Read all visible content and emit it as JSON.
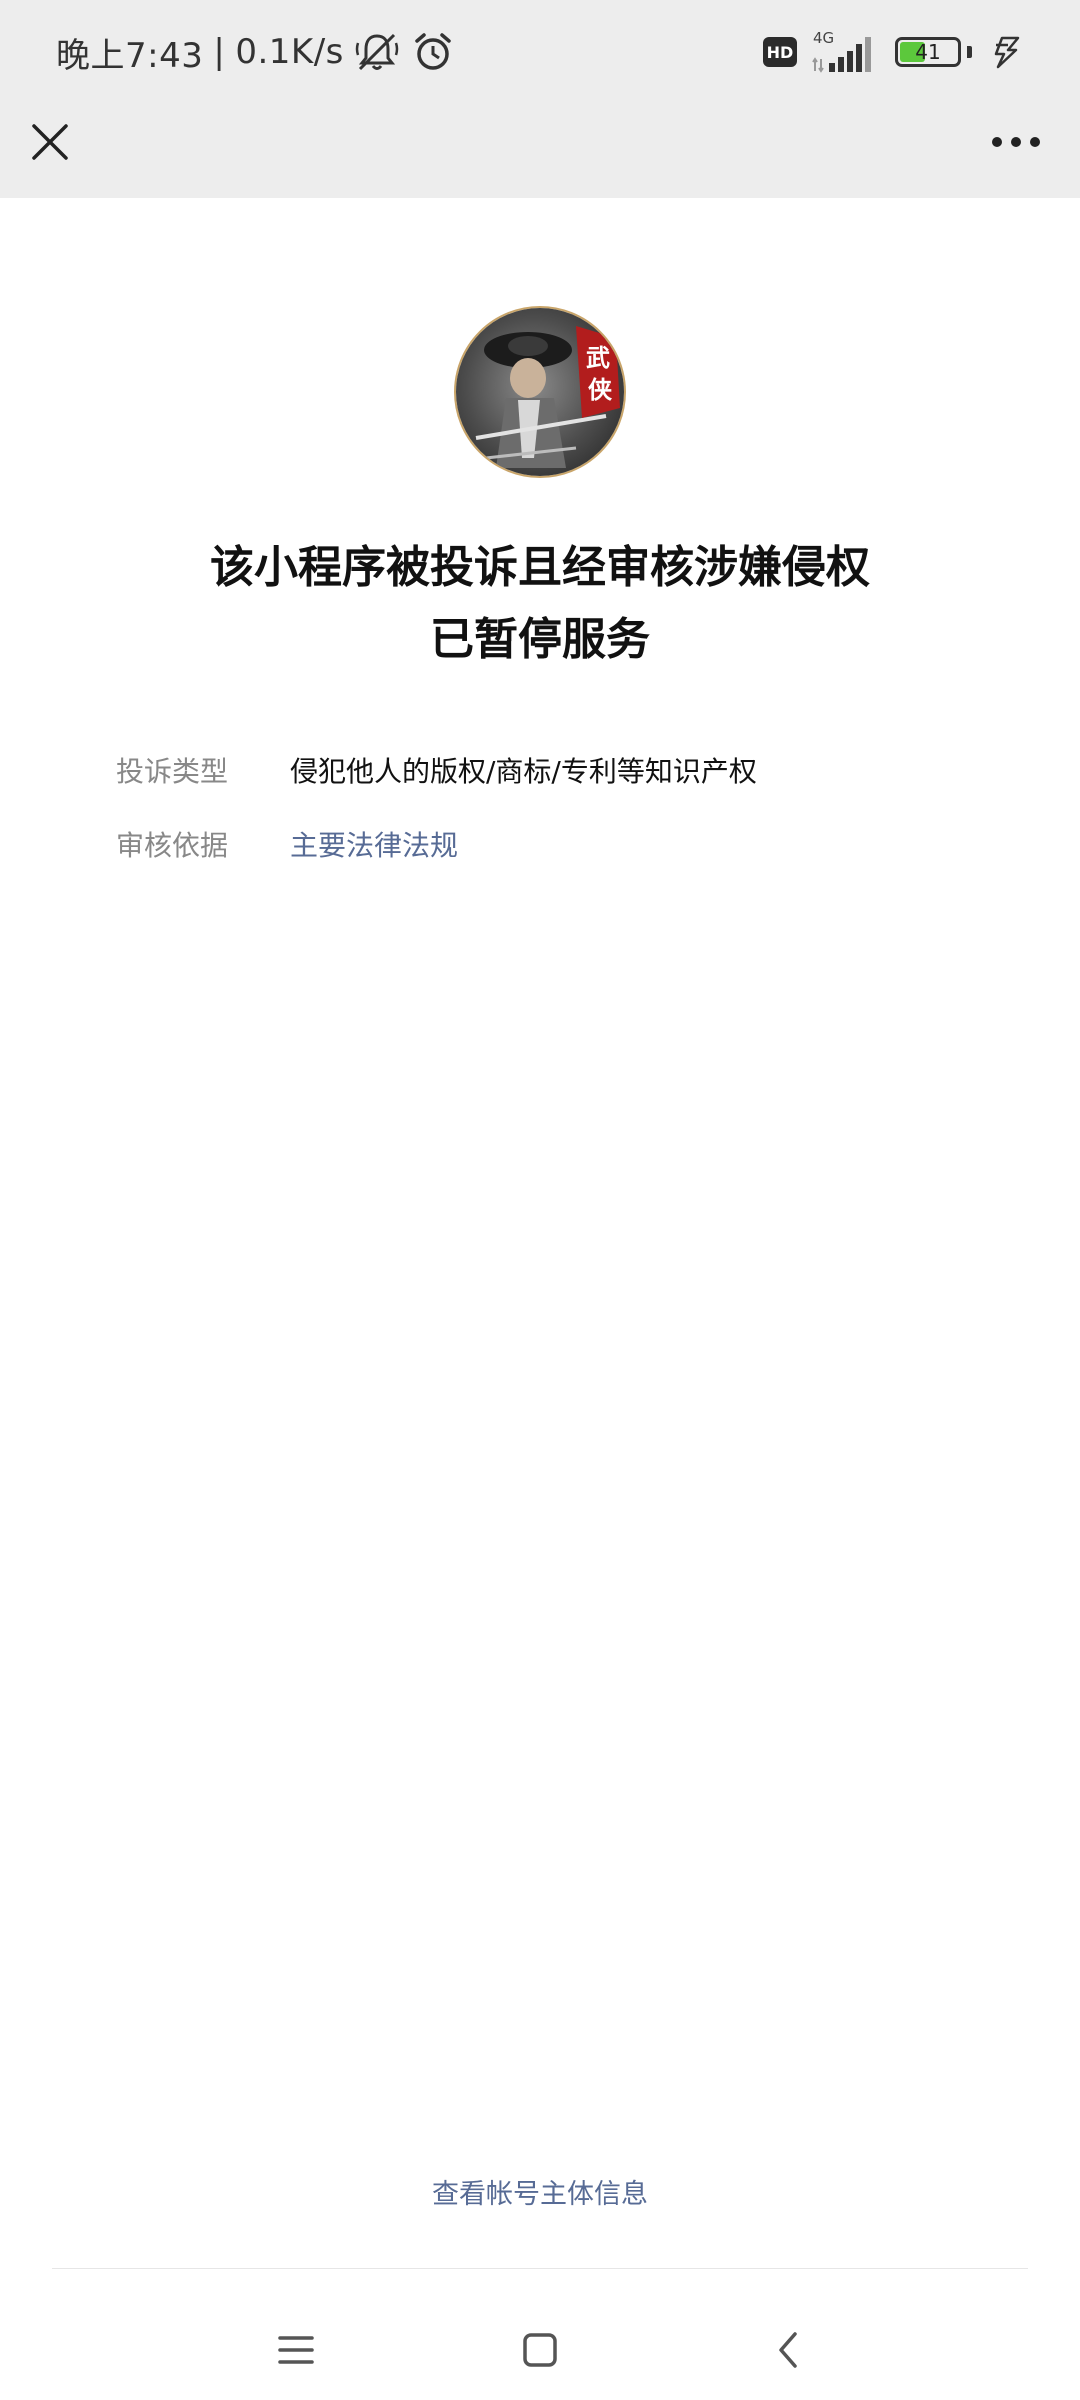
{
  "status_bar": {
    "time": "晚上7:43",
    "separator": "|",
    "net_speed": "0.1K/s",
    "hd_label": "HD",
    "network_type": "4G",
    "battery_level": "41",
    "icons": [
      "bell-muted-icon",
      "alarm-icon",
      "hd-icon",
      "signal-icon",
      "battery-icon",
      "charging-icon"
    ]
  },
  "title_bar": {
    "close_icon": "close-icon",
    "more_icon": "more-dots-icon"
  },
  "notice": {
    "title_line1": "该小程序被投诉且经审核涉嫌侵权",
    "title_line2": "已暂停服务"
  },
  "details": [
    {
      "label": "投诉类型",
      "value": "侵犯他人的版权/商标/专利等知识产权"
    },
    {
      "label": "审核依据",
      "value": "主要法律法规"
    }
  ],
  "footer": {
    "account_link": "查看帐号主体信息"
  },
  "nav_bar": {
    "icons": [
      "menu-icon",
      "home-icon",
      "back-icon"
    ]
  },
  "colors": {
    "top_background": "#ededed",
    "link": "#576b95",
    "label_gray": "#888888",
    "battery_green": "#5cc83c"
  }
}
